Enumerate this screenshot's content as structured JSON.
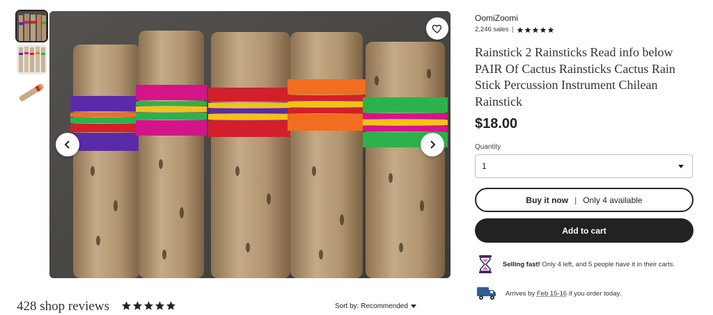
{
  "gallery": {
    "thumbnails": [
      {
        "label": "Rainsticks with colorful yarn",
        "selected": true
      },
      {
        "label": "Rainsticks on white background",
        "selected": false
      },
      {
        "label": "Single rainstick",
        "selected": false
      }
    ],
    "favorite_icon": "heart-icon",
    "prev_icon": "chevron-left-icon",
    "next_icon": "chevron-right-icon",
    "yarn_colors": [
      "#5a2aa8",
      "#d4148a",
      "#d1202c",
      "#f26d1f",
      "#2bb24c"
    ]
  },
  "shop": {
    "name": "OomiZoomi",
    "sales": "2,246 sales",
    "rating": 5
  },
  "listing": {
    "title": "Rainstick 2 Rainsticks Read info below PAIR Of Cactus Rainsticks Cactus Rain Stick Percussion Instrument Chilean Rainstick",
    "price": "$18.00"
  },
  "quantity": {
    "label": "Quantity",
    "value": "1"
  },
  "buttons": {
    "buy_now": "Buy it now",
    "buy_now_divider": "|",
    "availability": "Only 4 available",
    "add_to_cart": "Add to cart"
  },
  "notices": {
    "selling_fast_strong": "Selling fast!",
    "selling_fast_text": "Only 4 left, and 5 people have it in their carts.",
    "arrives_prefix": "Arrives by",
    "arrives_date": "Feb 15-16",
    "arrives_suffix": "if you order today."
  },
  "reviews": {
    "title": "428 shop reviews",
    "rating": 5,
    "sort_label": "Sort by: Recommended"
  },
  "colors": {
    "text": "#222222",
    "button_dark": "#222222",
    "hourglass": "#3b2a6e",
    "truck": "#2f5f8f"
  }
}
